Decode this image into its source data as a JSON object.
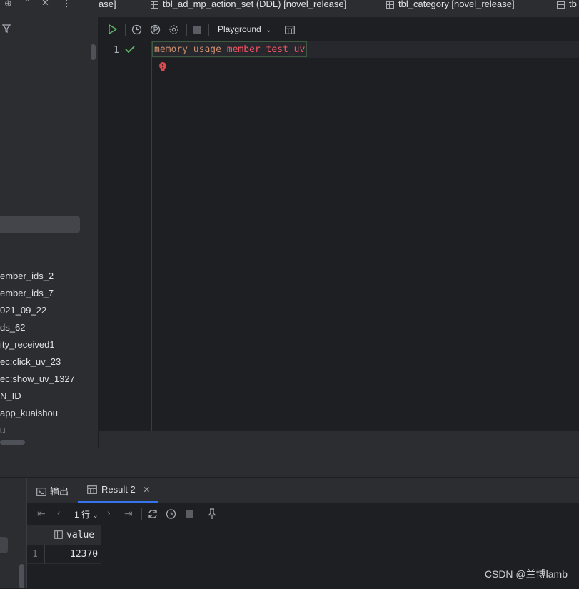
{
  "tabs": [
    {
      "label": "ase]"
    },
    {
      "label": "tbl_ad_mp_action_set (DDL) [novel_release]"
    },
    {
      "label": "tbl_category [novel_release]"
    },
    {
      "label": "tb"
    }
  ],
  "left_tree": {
    "items": [
      "ember_ids_2",
      "ember_ids_7",
      "021_09_22",
      "ds_62",
      "ity_received1",
      "ec:click_uv_23",
      "ec:show_uv_1327",
      "N_ID",
      "app_kuaishou",
      "u"
    ]
  },
  "editor": {
    "toolbar": {
      "session_label": "Playground"
    },
    "lines": [
      {
        "number": "1",
        "keyword1": "memory",
        "keyword2": "usage",
        "key": "member_test_uv"
      }
    ]
  },
  "bottom": {
    "tabs": [
      {
        "label": "输出"
      },
      {
        "label": "Result 2"
      }
    ],
    "pager": {
      "rows_label": "1 行"
    },
    "result": {
      "columns": [
        "value"
      ],
      "rows": [
        {
          "index": "1",
          "value": "12370"
        }
      ]
    }
  },
  "watermark": "CSDN @兰博lamb",
  "colors": {
    "keyword": "#cf8e6d",
    "key": "#f75464",
    "run": "#5fb865",
    "check": "#5fb865"
  }
}
